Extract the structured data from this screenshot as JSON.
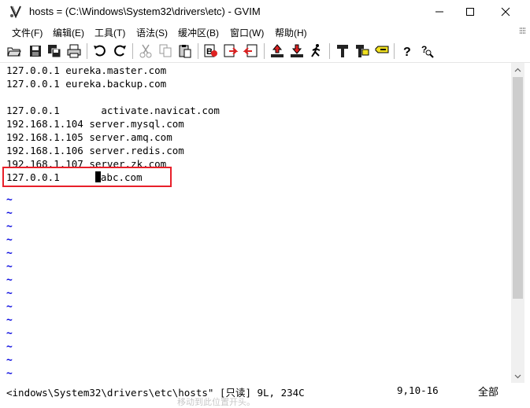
{
  "window": {
    "title": "hosts = (C:\\Windows\\System32\\drivers\\etc) - GVIM"
  },
  "menu": {
    "items": [
      "文件(F)",
      "编辑(E)",
      "工具(T)",
      "语法(S)",
      "缓冲区(B)",
      "窗口(W)",
      "帮助(H)"
    ]
  },
  "editor": {
    "lines": [
      "127.0.0.1 eureka.master.com",
      "127.0.0.1 eureka.backup.com",
      "",
      "127.0.0.1       activate.navicat.com",
      "192.168.1.104 server.mysql.com",
      "192.168.1.105 server.amq.com",
      "192.168.1.106 server.redis.com",
      "192.168.1.107 server.zk.com"
    ],
    "current_line_prefix": "127.0.0.1      ",
    "current_line_suffix": "abc.com",
    "tilde": "~"
  },
  "status": {
    "file": "<indows\\System32\\drivers\\etc\\hosts\" [只读] 9L, 234C",
    "position": "9,10-16",
    "scroll": "全部",
    "ghost": "移动到此位置开头。"
  },
  "colors": {
    "highlight_border": "#e8202a",
    "tilde": "#1010e0"
  }
}
